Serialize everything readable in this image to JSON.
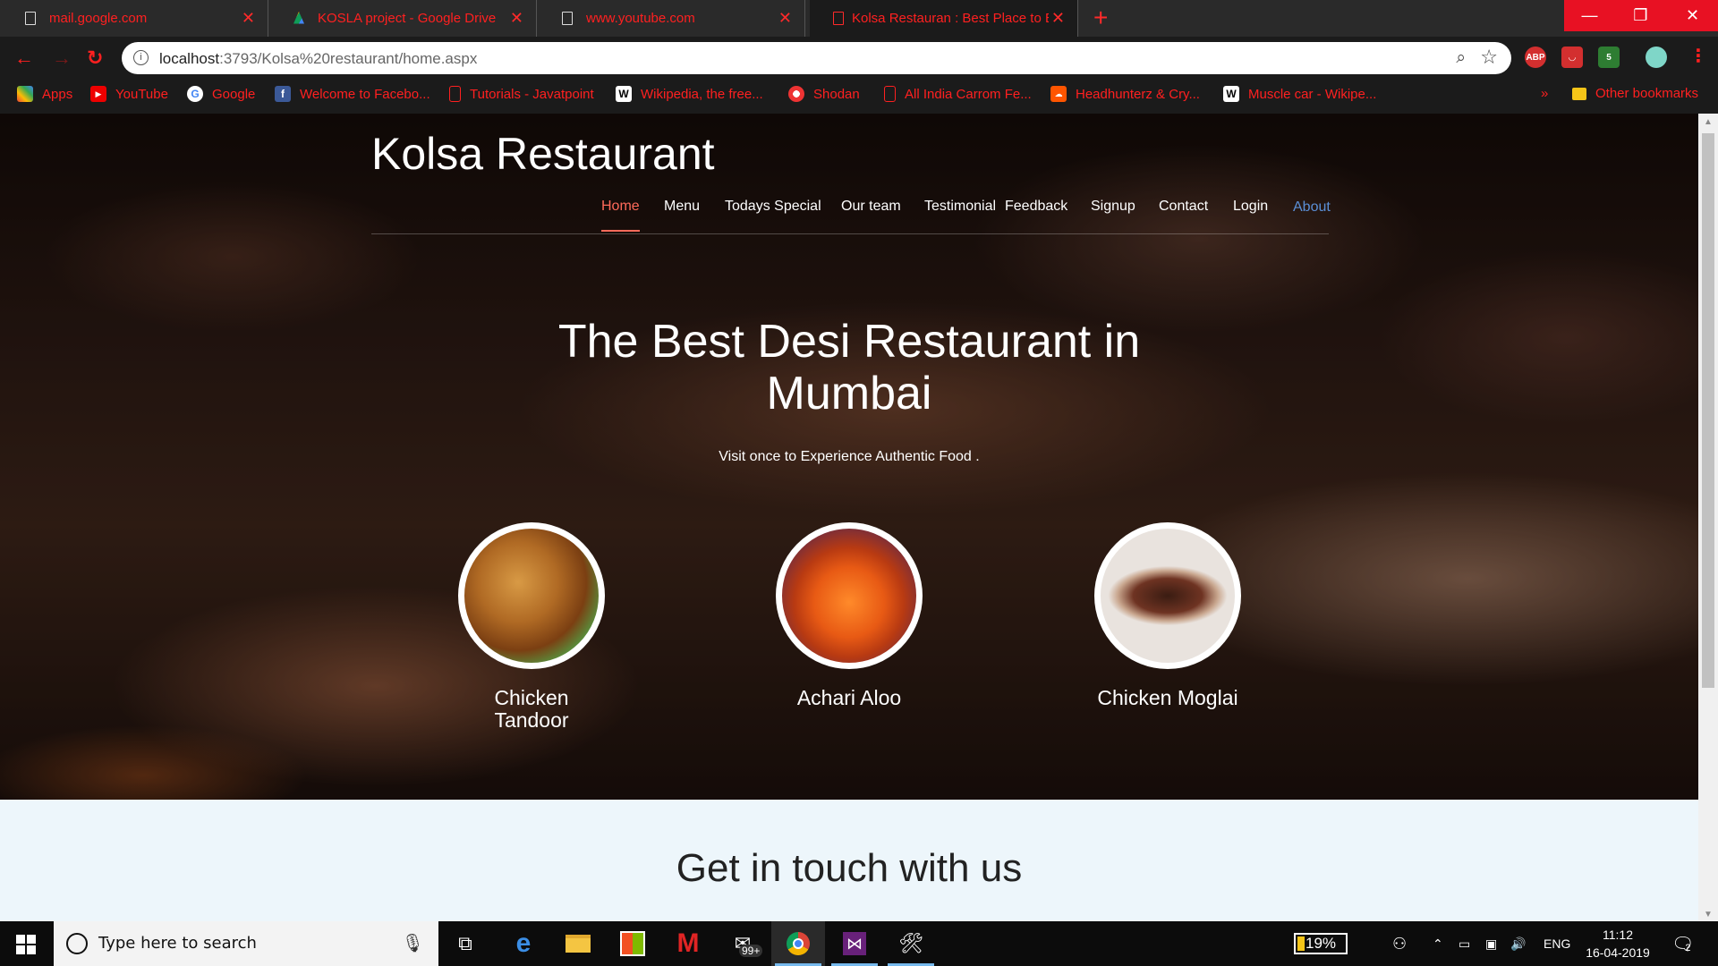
{
  "browser": {
    "tabs": [
      {
        "title": "mail.google.com",
        "active": false
      },
      {
        "title": "KOSLA project - Google Drive",
        "active": false
      },
      {
        "title": "www.youtube.com",
        "active": false
      },
      {
        "title": "Kolsa Restauran : Best Place to Ea",
        "active": true
      }
    ],
    "new_tab": "+",
    "url_host": "localhost",
    "url_rest": ":3793/Kolsa%20restaurant/home.aspx",
    "bookmarks": [
      {
        "label": "Apps",
        "icon": "apps-grid-icon"
      },
      {
        "label": "YouTube",
        "icon": "youtube-icon"
      },
      {
        "label": "Google",
        "icon": "google-icon"
      },
      {
        "label": "Welcome to Facebo...",
        "icon": "facebook-icon"
      },
      {
        "label": "Tutorials - Javatpoint",
        "icon": "page-icon"
      },
      {
        "label": "Wikipedia, the free...",
        "icon": "wikipedia-icon"
      },
      {
        "label": "Shodan",
        "icon": "shodan-icon"
      },
      {
        "label": "All India Carrom Fe...",
        "icon": "page-icon"
      },
      {
        "label": "Headhunterz & Cry...",
        "icon": "soundcloud-icon"
      },
      {
        "label": "Muscle car - Wikipe...",
        "icon": "wikipedia-icon"
      }
    ],
    "other_bookmarks": "Other bookmarks",
    "extensions": {
      "abp": "ABP",
      "badge": "5"
    }
  },
  "site": {
    "brand": "Kolsa Restaurant",
    "nav": [
      "Home",
      "Menu",
      "Todays Special",
      "Our team",
      "Testimonial",
      "Feedback",
      "Signup",
      "Contact",
      "Login",
      "About"
    ],
    "headline_line1": "The Best Desi Restaurant in",
    "headline_line2": "Mumbai",
    "tagline": "Visit once to Experience Authentic Food .",
    "dishes": [
      {
        "name_line1": "Chicken",
        "name_line2": "Tandoor"
      },
      {
        "name_line1": "Achari Aloo",
        "name_line2": ""
      },
      {
        "name_line1": "Chicken Moglai",
        "name_line2": ""
      }
    ],
    "contact_heading": "Get in touch with us"
  },
  "taskbar": {
    "search_placeholder": "Type here to search",
    "mail_badge": "99+",
    "battery": "19%",
    "language": "ENG",
    "time": "11:12",
    "date": "16-04-2019",
    "notifications": "2"
  }
}
